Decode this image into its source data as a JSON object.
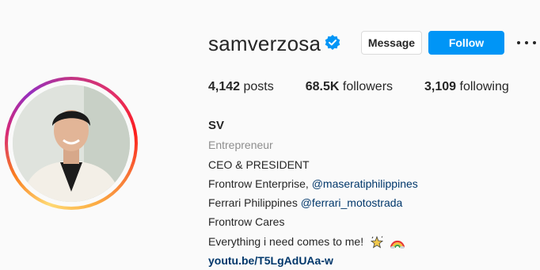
{
  "profile": {
    "username": "samverzosa",
    "message_label": "Message",
    "follow_label": "Follow"
  },
  "stats": {
    "posts_count": "4,142",
    "posts_label": " posts",
    "followers_count": "68.5K",
    "followers_label": " followers",
    "following_count": "3,109",
    "following_label": " following"
  },
  "bio": {
    "name": "SV",
    "category": "Entrepreneur",
    "line1": "CEO & PRESIDENT",
    "line2_text": "Frontrow Enterprise, ",
    "line2_mention": "@maseratiphilippines",
    "line3_text": "Ferrari Philippines ",
    "line3_mention": "@ferrari_motostrada",
    "line4": "Frontrow Cares",
    "line5": "Everything i need comes to me!",
    "link": "youtu.be/T5LgAdUAa-w"
  },
  "icons": {
    "verified": "verified-badge-icon",
    "more": "more-options-icon",
    "emoji1": "sparkle-star-emoji",
    "emoji2": "rainbow-emoji"
  },
  "colors": {
    "follow_button": "#0095f6",
    "verified_badge": "#0095f6",
    "mention": "#00376b",
    "category": "#8e8e8e"
  }
}
